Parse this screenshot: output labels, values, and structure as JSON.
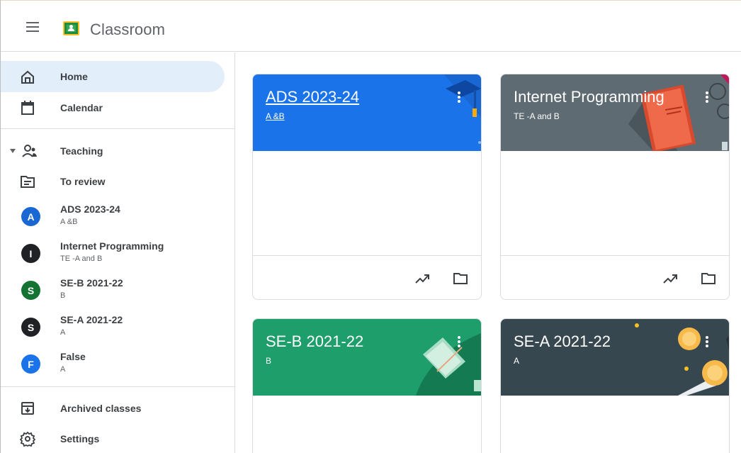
{
  "app": {
    "title": "Classroom"
  },
  "sidebar": {
    "home": "Home",
    "calendar": "Calendar",
    "teaching": "Teaching",
    "to_review": "To review",
    "classes": [
      {
        "letter": "A",
        "name": "ADS 2023-24",
        "section": "A &B",
        "color": "#1967d2"
      },
      {
        "letter": "I",
        "name": "Internet Programming",
        "section": "TE -A and B",
        "color": "#202124"
      },
      {
        "letter": "S",
        "name": "SE-B 2021-22",
        "section": "B",
        "color": "#137333"
      },
      {
        "letter": "S",
        "name": "SE-A 2021-22",
        "section": "A",
        "color": "#202124"
      },
      {
        "letter": "F",
        "name": "False",
        "section": "A",
        "color": "#1a73e8"
      }
    ],
    "archived": "Archived classes",
    "settings": "Settings"
  },
  "cards": [
    {
      "title": "ADS 2023-24",
      "section": "A &B",
      "banner_color": "#1a73e8"
    },
    {
      "title": "Internet Programming",
      "section": "TE -A and B",
      "banner_color": "#5f6b73"
    },
    {
      "title": "SE-B 2021-22",
      "section": "B",
      "banner_color": "#1e9e6a"
    },
    {
      "title": "SE-A 2021-22",
      "section": "A",
      "banner_color": "#37474f"
    }
  ],
  "icons": {
    "menu": "menu-icon",
    "home": "home-icon",
    "calendar": "calendar-icon",
    "teaching": "people-icon",
    "review": "review-folder-icon",
    "archived": "archive-icon",
    "settings": "gear-icon",
    "trending": "trending-up-icon",
    "folder": "folder-icon",
    "more": "more-vert-icon"
  }
}
